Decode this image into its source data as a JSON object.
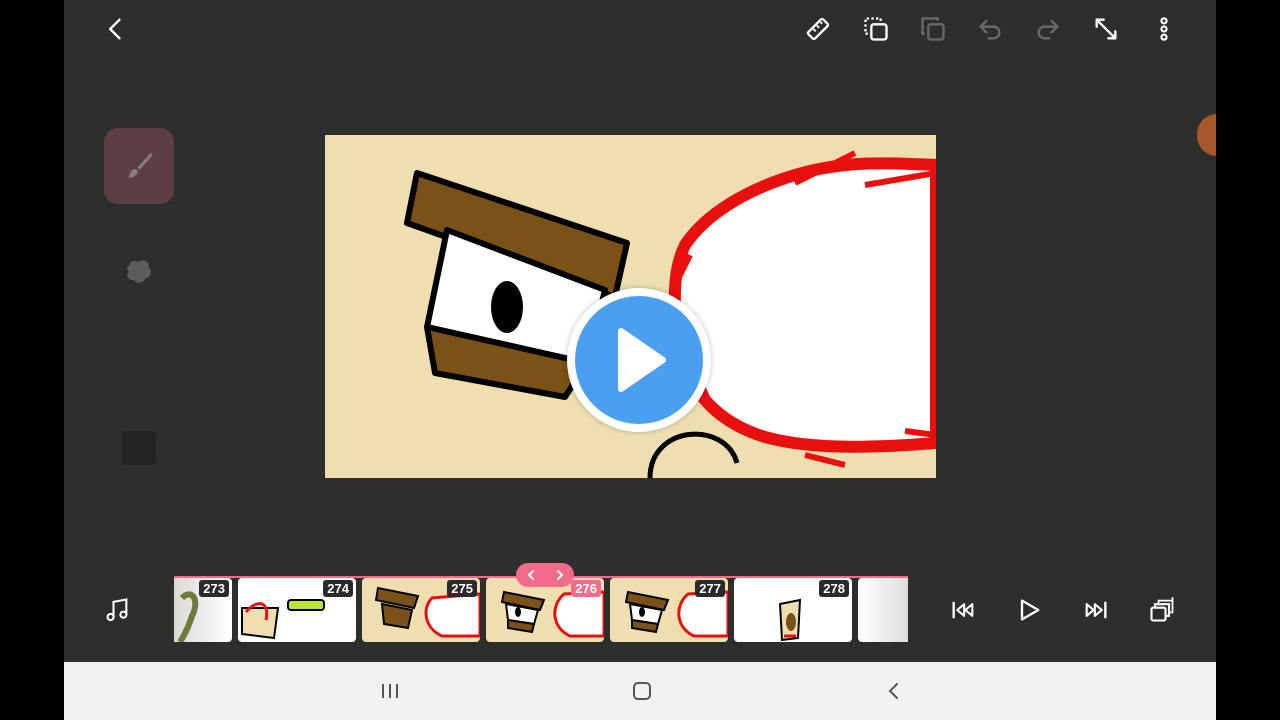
{
  "toolbar": {
    "icons": [
      "back-icon",
      "ruler-icon",
      "copy-layer-icon",
      "paste-layer-icon",
      "undo-icon",
      "redo-icon",
      "fullscreen-icon",
      "more-icon"
    ]
  },
  "timeline": {
    "frames": [
      {
        "number": "273"
      },
      {
        "number": "274"
      },
      {
        "number": "275"
      },
      {
        "number": "276"
      },
      {
        "number": "277"
      },
      {
        "number": "278"
      }
    ],
    "current_frame": "276"
  },
  "colors": {
    "background": "#2e2f2d",
    "canvas": "#efdfb0",
    "accent": "#f26b8a",
    "play": "#4aa0f0",
    "brown": "#7a5217",
    "red": "#e8100f"
  }
}
